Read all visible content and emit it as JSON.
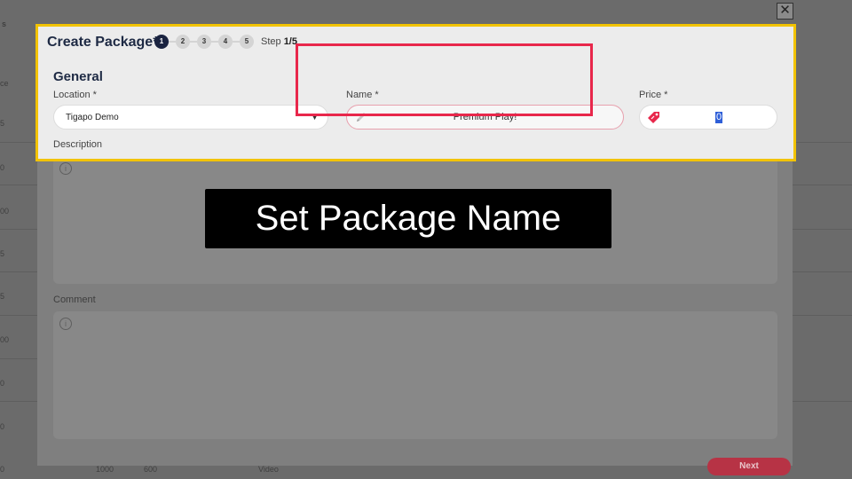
{
  "modal": {
    "title": "Create Package*",
    "steps": [
      "1",
      "2",
      "3",
      "4",
      "5"
    ],
    "step_prefix": "Step ",
    "step_indicator": "1/5",
    "section_title": "General",
    "location": {
      "label": "Location *",
      "value": "Tigapo Demo"
    },
    "name": {
      "label": "Name *",
      "value": "Premium Play!"
    },
    "price": {
      "label": "Price *",
      "value": "0"
    },
    "description": {
      "label": "Description"
    },
    "comment": {
      "label": "Comment"
    },
    "next_label": "Next"
  },
  "caption": "Set Package Name",
  "background": {
    "top_label": "s",
    "header_label": "ce",
    "row_values": [
      "5",
      "0",
      "00",
      "5",
      "5",
      "00",
      "0",
      "0",
      "0"
    ],
    "bottom_values": [
      "1000",
      "600",
      "Video"
    ]
  },
  "colors": {
    "highlight_yellow": "#f2c300",
    "highlight_red": "#e8274b",
    "accent_navy": "#1a2340",
    "next_button": "#b73345"
  },
  "icons": {
    "close": "close-icon",
    "pencil": "pencil-icon",
    "price_tag": "tag-icon",
    "info": "info-icon",
    "caret": "chevron-down-icon"
  }
}
